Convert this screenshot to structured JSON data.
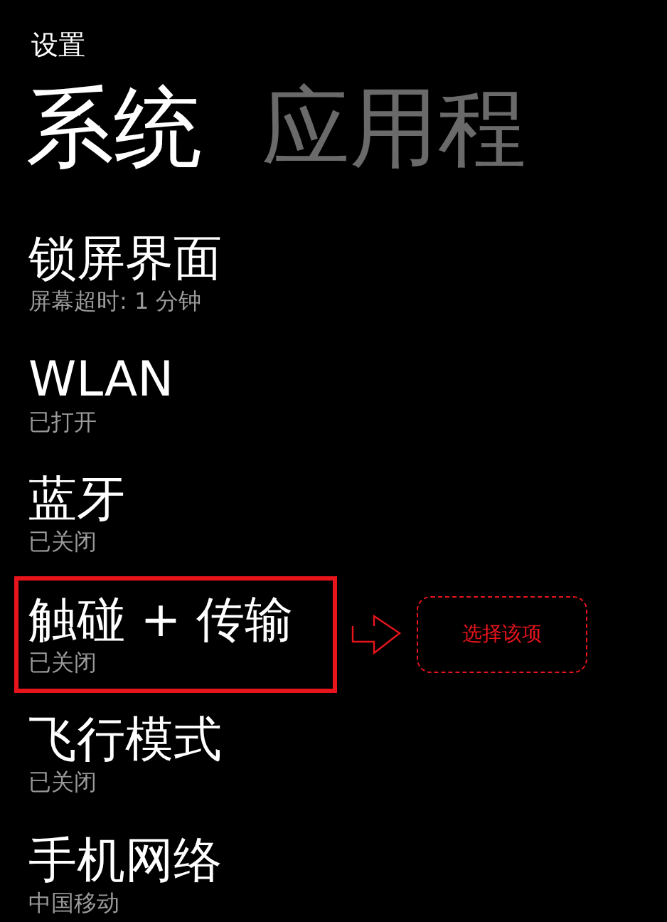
{
  "app_title": "设置",
  "pivots": [
    {
      "label": "系统",
      "selected": true
    },
    {
      "label": "应用程",
      "selected": false
    }
  ],
  "settings": [
    {
      "title": "锁屏界面",
      "subtitle": "屏幕超时: 1 分钟",
      "highlighted": false
    },
    {
      "title": "WLAN",
      "subtitle": "已打开",
      "highlighted": false
    },
    {
      "title": "蓝牙",
      "subtitle": "已关闭",
      "highlighted": false
    },
    {
      "title": "触碰 + 传输",
      "subtitle": "已关闭",
      "highlighted": true
    },
    {
      "title": "飞行模式",
      "subtitle": "已关闭",
      "highlighted": false
    },
    {
      "title": "手机网络",
      "subtitle": "中国移动",
      "highlighted": false
    }
  ],
  "annotation": {
    "label": "选择该项"
  }
}
